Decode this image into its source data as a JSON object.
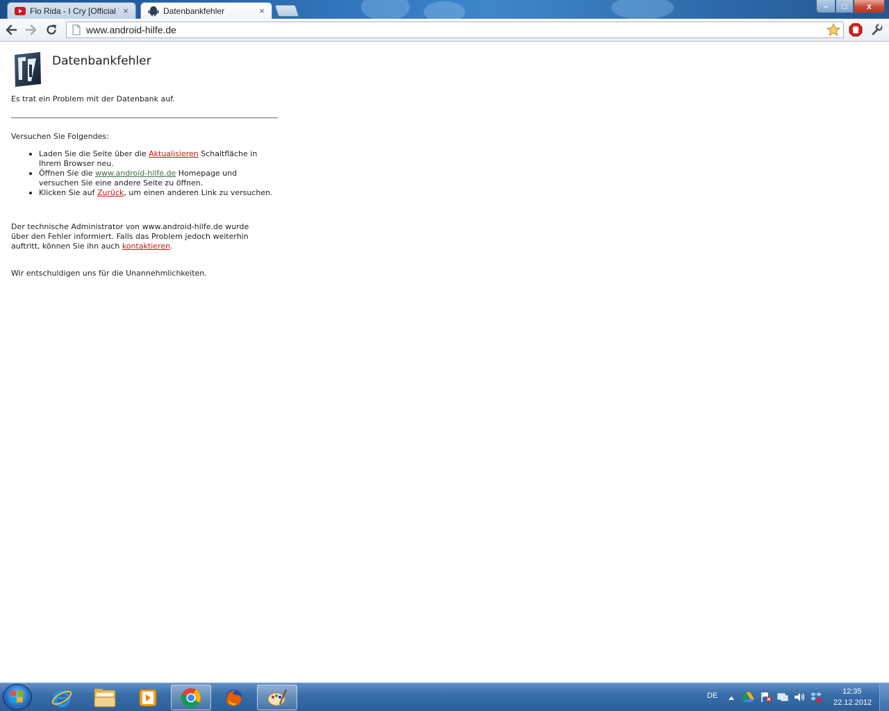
{
  "browser": {
    "tabs": [
      {
        "title": "Flo Rida - I Cry [Official Vi",
        "favicon": "youtube-icon",
        "active": false
      },
      {
        "title": "Datenbankfehler",
        "favicon": "android-icon",
        "active": true
      }
    ],
    "close_glyph": "×",
    "window_controls": {
      "minimize": "–",
      "maximize": "□",
      "close": "x"
    },
    "url": "www.android-hilfe.de"
  },
  "page": {
    "title": "Datenbankfehler",
    "intro": "Es trat ein Problem mit der Datenbank auf.",
    "try_heading": "Versuchen Sie Folgendes:",
    "bullets": {
      "b1_pre": "Laden Sie die Seite über die ",
      "b1_link": "Aktualisieren",
      "b1_post": " Schaltfläche in Ihrem Browser neu.",
      "b2_pre": "Öffnen Sie die ",
      "b2_link": "www.android-hilfe.de",
      "b2_post": " Homepage und versuchen Sie eine andere Seite zu öffnen.",
      "b3_pre": "Klicken Sie auf ",
      "b3_link": "Zurück",
      "b3_post": ", um einen anderen Link zu versuchen."
    },
    "admin_pre": "Der technische Administrator von www.android-hilfe.de wurde über den Fehler informiert. Falls das Problem jedoch weiterhin auftritt, können Sie ihn auch ",
    "admin_link": "kontaktieren",
    "admin_post": ".",
    "apology": "Wir entschuldigen uns für die Unannehmlichkeiten."
  },
  "taskbar": {
    "apps": [
      "internet-explorer-icon",
      "windows-explorer-icon",
      "media-player-icon",
      "chrome-icon",
      "firefox-icon",
      "paint-icon"
    ],
    "active_app": "chrome-icon",
    "language": "DE",
    "time": "12:35",
    "date": "22.12.2012"
  },
  "colors": {
    "link_red": "#c4170b",
    "link_green": "#3d6b48",
    "taskbar": "#3a6ea8",
    "titlebar": "#2b6bb3"
  }
}
